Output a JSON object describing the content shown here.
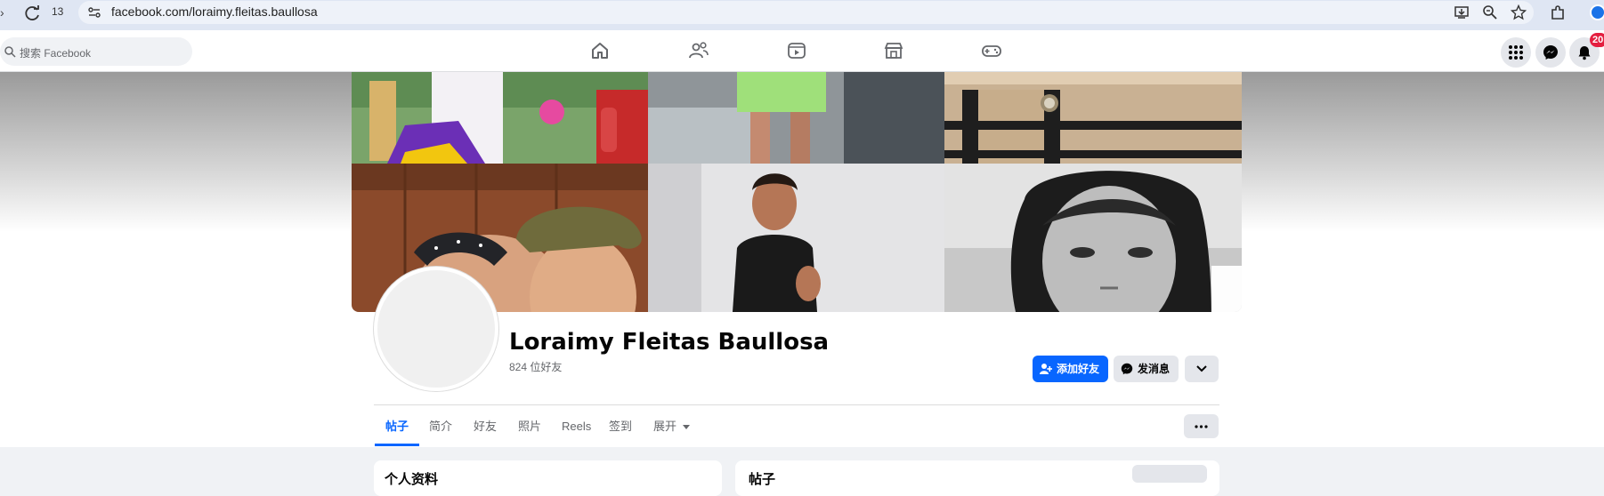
{
  "browser": {
    "tab_count": "13",
    "url": "facebook.com/loraimy.fleitas.baullosa"
  },
  "nav": {
    "search_placeholder": "搜索 Facebook",
    "center_tabs": [
      "home-icon",
      "friends-icon",
      "video-icon",
      "marketplace-icon",
      "gaming-icon"
    ],
    "notification_badge": "20"
  },
  "profile": {
    "name": "Loraimy Fleitas Baullosa",
    "friends": "824 位好友",
    "add_friend_label": "添加好友",
    "message_label": "发消息"
  },
  "tabs": [
    {
      "label": "帖子",
      "active": true
    },
    {
      "label": "简介",
      "active": false
    },
    {
      "label": "好友",
      "active": false
    },
    {
      "label": "照片",
      "active": false
    },
    {
      "label": "Reels",
      "active": false
    },
    {
      "label": "签到",
      "active": false
    },
    {
      "label": "展开",
      "active": false
    }
  ],
  "cards": {
    "intro_title": "个人资料",
    "posts_title": "帖子"
  },
  "colors": {
    "accent": "#0866ff",
    "badge": "#e41e3f",
    "surface": "#e4e6eb"
  }
}
